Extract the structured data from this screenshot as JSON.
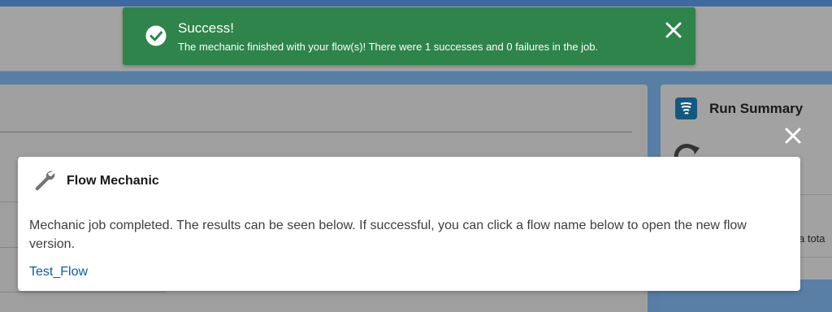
{
  "toast": {
    "title": "Success!",
    "message": "The mechanic finished with your flow(s)! There were 1 successes and 0 failures in the job.",
    "color": "#2e844a"
  },
  "side_panel": {
    "title": "Run Summary",
    "partial_text": "a tota"
  },
  "modal": {
    "title": "Flow Mechanic",
    "body": "Mechanic job completed. The results can be seen below. If successful, you can click a flow name below to open the new flow version.",
    "link": "Test_Flow",
    "link_color": "#0b5cab"
  },
  "icons": {
    "toast_status": "check-circle-icon",
    "toast_close": "close-icon",
    "modal_close": "close-icon",
    "modal_header": "wrench-icon",
    "run_summary": "flow-icon",
    "refresh": "refresh-icon"
  }
}
